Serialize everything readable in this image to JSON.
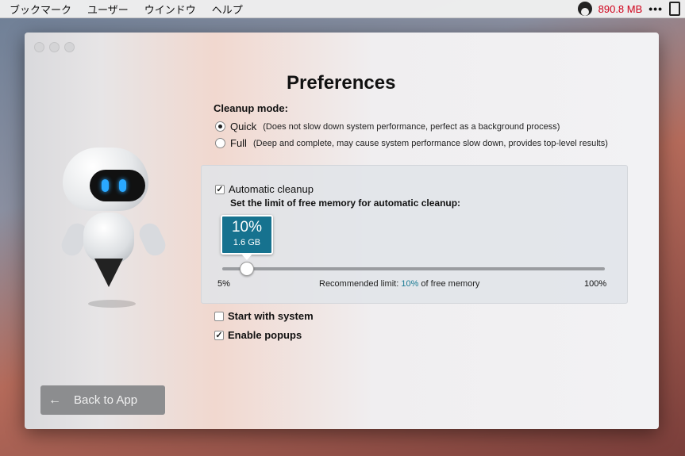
{
  "menubar": {
    "items": [
      "ブックマーク",
      "ユーザー",
      "ウインドウ",
      "ヘルプ"
    ],
    "memory": "890.8 MB",
    "more": "•••"
  },
  "window": {
    "title": "Preferences",
    "cleanup_mode": {
      "label": "Cleanup mode:",
      "options": [
        {
          "label": "Quick",
          "desc": "(Does not slow down system performance, perfect as a background process)",
          "selected": true
        },
        {
          "label": "Full",
          "desc": "(Deep and complete, may cause system performance slow down, provides top-level results)",
          "selected": false
        }
      ]
    },
    "automatic_cleanup": {
      "label": "Automatic cleanup",
      "checked": true,
      "limit_label": "Set the limit of free memory for automatic cleanup:",
      "bubble_percent": "10%",
      "bubble_size": "1.6 GB",
      "slider_value_percent": 10,
      "min_label": "5%",
      "max_label": "100%",
      "recommended_prefix": "Recommended limit:",
      "recommended_value": "10%",
      "recommended_suffix": "of free memory"
    },
    "start_with_system": {
      "label": "Start with system",
      "checked": false
    },
    "enable_popups": {
      "label": "Enable popups",
      "checked": true
    },
    "back_button": {
      "arrow": "←",
      "label": "Back to App"
    }
  },
  "colors": {
    "accent": "#16728f",
    "memory_text": "#d0021b"
  }
}
